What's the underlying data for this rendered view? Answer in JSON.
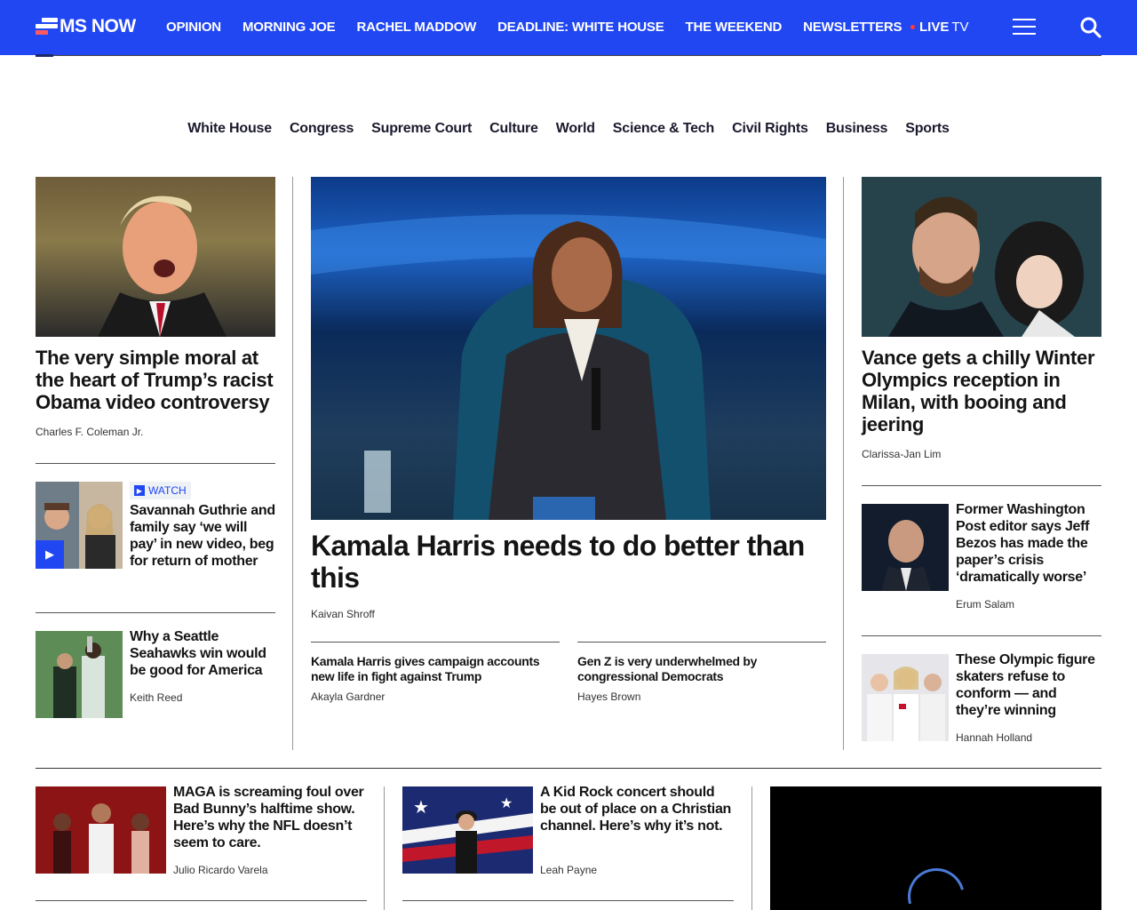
{
  "header": {
    "logo_text": "MS NOW",
    "nav": [
      "OPINION",
      "MORNING JOE",
      "RACHEL MADDOW",
      "DEADLINE: WHITE HOUSE",
      "THE WEEKEND",
      "NEWSLETTERS"
    ],
    "live_bold": "LIVE",
    "live_rest": "TV",
    "brand_color": "#2147f3"
  },
  "sections": [
    "White House",
    "Congress",
    "Supreme Court",
    "Culture",
    "World",
    "Science & Tech",
    "Civil Rights",
    "Business",
    "Sports"
  ],
  "left": {
    "main": {
      "headline": "The very simple moral at the heart of Trump’s racist Obama video controversy",
      "byline": "Charles F. Coleman Jr."
    },
    "guthrie": {
      "badge": "WATCH",
      "headline": "Savannah Guthrie and family say ‘we will pay’ in new video, beg for return of mother"
    },
    "seahawks": {
      "headline": "Why a Seattle Seahawks win would be good for America",
      "byline": "Keith Reed"
    }
  },
  "center": {
    "main": {
      "headline": "Kamala Harris needs to do better than this",
      "byline": "Kaivan Shroff"
    },
    "sub1": {
      "headline": "Kamala Harris gives campaign accounts new life in fight against Trump",
      "byline": "Akayla Gardner"
    },
    "sub2": {
      "headline": "Gen Z is very underwhelmed by congressional Democrats",
      "byline": "Hayes Brown"
    }
  },
  "right": {
    "main": {
      "headline": "Vance gets a chilly Winter Olympics reception in Milan, with booing and jeering",
      "byline": "Clarissa-Jan Lim"
    },
    "bezos": {
      "headline": "Former Washington Post editor says Jeff Bezos has made the paper’s crisis ‘dramatically worse’",
      "byline": "Erum Salam"
    },
    "skaters": {
      "headline": "These Olympic figure skaters refuse to conform — and they’re winning",
      "byline": "Hannah Holland"
    }
  },
  "bottom": {
    "badbunny": {
      "headline": "MAGA is screaming foul over Bad Bunny’s halftime show. Here’s why the NFL doesn’t seem to care.",
      "byline": "Julio Ricardo Varela"
    },
    "kidrock": {
      "headline": "A Kid Rock concert should be out of place on a Christian channel. Here’s why it’s not.",
      "byline": "Leah Payne"
    }
  }
}
